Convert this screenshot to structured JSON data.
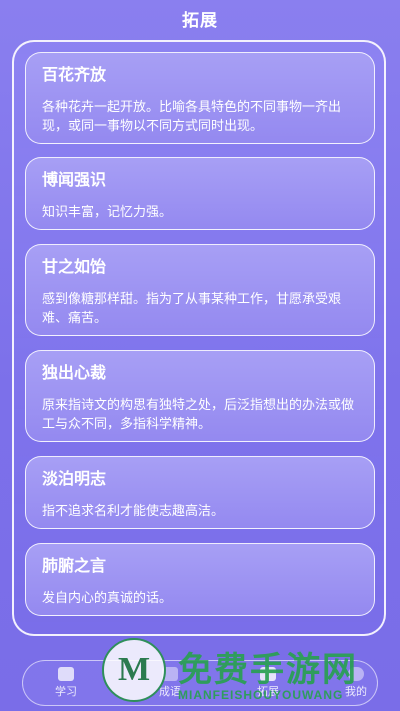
{
  "header": {
    "title": "拓展"
  },
  "idioms": [
    {
      "title": "百花齐放",
      "desc": "各种花卉一起开放。比喻各具特色的不同事物一齐出现，或同一事物以不同方式同时出现。"
    },
    {
      "title": "博闻强识",
      "desc": "知识丰富，记忆力强。"
    },
    {
      "title": "甘之如饴",
      "desc": "感到像糖那样甜。指为了从事某种工作，甘愿承受艰难、痛苦。"
    },
    {
      "title": "独出心裁",
      "desc": "原来指诗文的构思有独特之处，后泛指想出的办法或做工与众不同，多指科学精神。"
    },
    {
      "title": "淡泊明志",
      "desc": "指不追求名利才能使志趣高洁。"
    },
    {
      "title": "肺腑之言",
      "desc": "发自内心的真诚的话。"
    }
  ],
  "tabbar": {
    "tabs": [
      {
        "label": "学习",
        "icon": "book-icon"
      },
      {
        "label": "成语",
        "icon": "dictionary-icon"
      },
      {
        "label": "拓展",
        "icon": "expand-icon",
        "active": true
      },
      {
        "label": "我的",
        "icon": "user-icon"
      }
    ]
  },
  "watermark": {
    "logo_letter": "M",
    "text": "免费手游网",
    "url": "MIANFEISHOUYOUWANG"
  }
}
